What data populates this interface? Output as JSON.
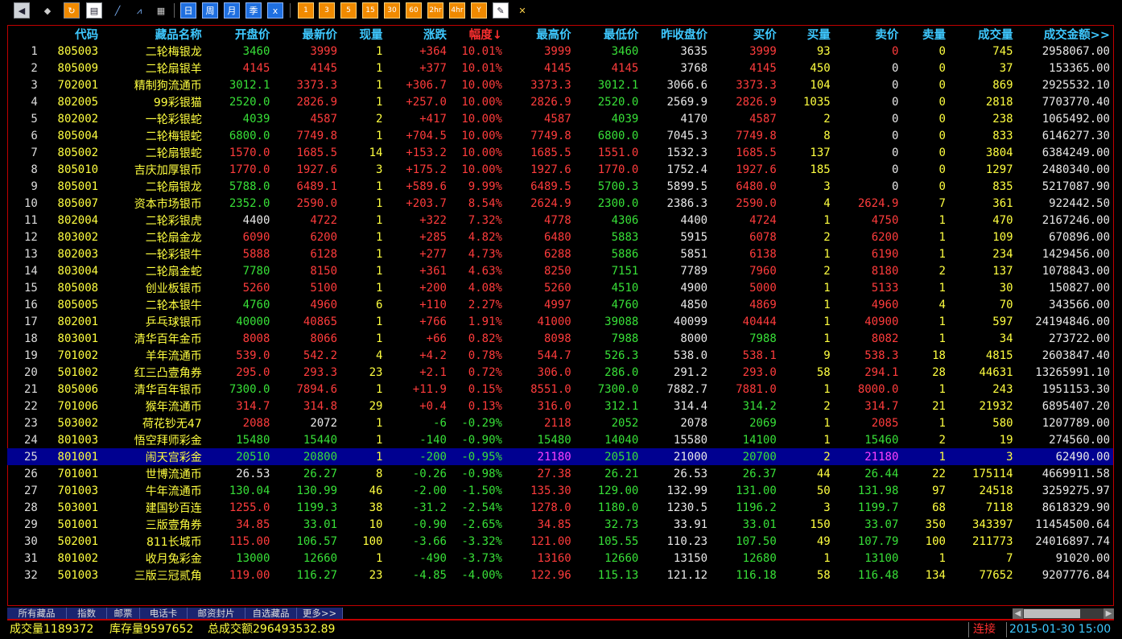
{
  "toolbar": {
    "icons": [
      "back-icon",
      "cube-icon",
      "refresh-icon",
      "quote-list-icon",
      "chart-icon",
      "analysis-icon",
      "table-icon"
    ],
    "periods": [
      "日",
      "周",
      "月",
      "季",
      "x"
    ],
    "minutes": [
      "1",
      "3",
      "5",
      "15",
      "30",
      "60",
      "2hr",
      "4hr",
      "Y"
    ],
    "tools": [
      "edit-icon",
      "tools-icon"
    ]
  },
  "headers": [
    "",
    "代码",
    "藏品名称",
    "开盘价",
    "最新价",
    "现量",
    "涨跌",
    "幅度↓",
    "最高价",
    "最低价",
    "昨收盘价",
    "买价",
    "买量",
    "卖价",
    "卖量",
    "成交量",
    "成交金额>>"
  ],
  "rows": [
    [
      "1",
      "805003",
      "二轮梅银龙",
      "3460",
      "3999",
      "1",
      "+364",
      "10.01%",
      "3999",
      "3460",
      "3635",
      "3999",
      "93",
      "0",
      "0",
      "745",
      "2958067.00"
    ],
    [
      "2",
      "805009",
      "二轮扇银羊",
      "4145",
      "4145",
      "1",
      "+377",
      "10.01%",
      "4145",
      "4145",
      "3768",
      "4145",
      "450",
      "0",
      "0",
      "37",
      "153365.00"
    ],
    [
      "3",
      "702001",
      "精制狗流通币",
      "3012.1",
      "3373.3",
      "1",
      "+306.7",
      "10.00%",
      "3373.3",
      "3012.1",
      "3066.6",
      "3373.3",
      "104",
      "0",
      "0",
      "869",
      "2925532.10"
    ],
    [
      "4",
      "802005",
      "99彩银猫",
      "2520.0",
      "2826.9",
      "1",
      "+257.0",
      "10.00%",
      "2826.9",
      "2520.0",
      "2569.9",
      "2826.9",
      "1035",
      "0",
      "0",
      "2818",
      "7703770.40"
    ],
    [
      "5",
      "802002",
      "一轮彩银蛇",
      "4039",
      "4587",
      "2",
      "+417",
      "10.00%",
      "4587",
      "4039",
      "4170",
      "4587",
      "2",
      "0",
      "0",
      "238",
      "1065492.00"
    ],
    [
      "6",
      "805004",
      "二轮梅银蛇",
      "6800.0",
      "7749.8",
      "1",
      "+704.5",
      "10.00%",
      "7749.8",
      "6800.0",
      "7045.3",
      "7749.8",
      "8",
      "0",
      "0",
      "833",
      "6146277.30"
    ],
    [
      "7",
      "805002",
      "二轮扇银蛇",
      "1570.0",
      "1685.5",
      "14",
      "+153.2",
      "10.00%",
      "1685.5",
      "1551.0",
      "1532.3",
      "1685.5",
      "137",
      "0",
      "0",
      "3804",
      "6384249.00"
    ],
    [
      "8",
      "805010",
      "吉庆加厚银币",
      "1770.0",
      "1927.6",
      "3",
      "+175.2",
      "10.00%",
      "1927.6",
      "1770.0",
      "1752.4",
      "1927.6",
      "185",
      "0",
      "0",
      "1297",
      "2480340.00"
    ],
    [
      "9",
      "805001",
      "二轮扇银龙",
      "5788.0",
      "6489.1",
      "1",
      "+589.6",
      "9.99%",
      "6489.5",
      "5700.3",
      "5899.5",
      "6480.0",
      "3",
      "0",
      "0",
      "835",
      "5217087.90"
    ],
    [
      "10",
      "805007",
      "资本市场银币",
      "2352.0",
      "2590.0",
      "1",
      "+203.7",
      "8.54%",
      "2624.9",
      "2300.0",
      "2386.3",
      "2590.0",
      "4",
      "2624.9",
      "7",
      "361",
      "922442.50"
    ],
    [
      "11",
      "802004",
      "二轮彩银虎",
      "4400",
      "4722",
      "1",
      "+322",
      "7.32%",
      "4778",
      "4306",
      "4400",
      "4724",
      "1",
      "4750",
      "1",
      "470",
      "2167246.00"
    ],
    [
      "12",
      "803002",
      "二轮扇金龙",
      "6090",
      "6200",
      "1",
      "+285",
      "4.82%",
      "6480",
      "5883",
      "5915",
      "6078",
      "2",
      "6200",
      "1",
      "109",
      "670896.00"
    ],
    [
      "13",
      "802003",
      "一轮彩银牛",
      "5888",
      "6128",
      "1",
      "+277",
      "4.73%",
      "6288",
      "5886",
      "5851",
      "6138",
      "1",
      "6190",
      "1",
      "234",
      "1429456.00"
    ],
    [
      "14",
      "803004",
      "二轮扇金蛇",
      "7780",
      "8150",
      "1",
      "+361",
      "4.63%",
      "8250",
      "7151",
      "7789",
      "7960",
      "2",
      "8180",
      "2",
      "137",
      "1078843.00"
    ],
    [
      "15",
      "805008",
      "创业板银币",
      "5260",
      "5100",
      "1",
      "+200",
      "4.08%",
      "5260",
      "4510",
      "4900",
      "5000",
      "1",
      "5133",
      "1",
      "30",
      "150827.00"
    ],
    [
      "16",
      "805005",
      "二轮本银牛",
      "4760",
      "4960",
      "6",
      "+110",
      "2.27%",
      "4997",
      "4760",
      "4850",
      "4869",
      "1",
      "4960",
      "4",
      "70",
      "343566.00"
    ],
    [
      "17",
      "802001",
      "乒乓球银币",
      "40000",
      "40865",
      "1",
      "+766",
      "1.91%",
      "41000",
      "39088",
      "40099",
      "40444",
      "1",
      "40900",
      "1",
      "597",
      "24194846.00"
    ],
    [
      "18",
      "803001",
      "清华百年金币",
      "8008",
      "8066",
      "1",
      "+66",
      "0.82%",
      "8098",
      "7988",
      "8000",
      "7988",
      "1",
      "8082",
      "1",
      "34",
      "273722.00"
    ],
    [
      "19",
      "701002",
      "羊年流通币",
      "539.0",
      "542.2",
      "4",
      "+4.2",
      "0.78%",
      "544.7",
      "526.3",
      "538.0",
      "538.1",
      "9",
      "538.3",
      "18",
      "4815",
      "2603847.40"
    ],
    [
      "20",
      "501002",
      "红三凸壹角券",
      "295.0",
      "293.3",
      "23",
      "+2.1",
      "0.72%",
      "306.0",
      "286.0",
      "291.2",
      "293.0",
      "58",
      "294.1",
      "28",
      "44631",
      "13265991.10"
    ],
    [
      "21",
      "805006",
      "清华百年银币",
      "7300.0",
      "7894.6",
      "1",
      "+11.9",
      "0.15%",
      "8551.0",
      "7300.0",
      "7882.7",
      "7881.0",
      "1",
      "8000.0",
      "1",
      "243",
      "1951153.30"
    ],
    [
      "22",
      "701006",
      "猴年流通币",
      "314.7",
      "314.8",
      "29",
      "+0.4",
      "0.13%",
      "316.0",
      "312.1",
      "314.4",
      "314.2",
      "2",
      "314.7",
      "21",
      "21932",
      "6895407.20"
    ],
    [
      "23",
      "503002",
      "荷花钞无47",
      "2088",
      "2072",
      "1",
      "-6",
      "-0.29%",
      "2118",
      "2052",
      "2078",
      "2069",
      "1",
      "2085",
      "1",
      "580",
      "1207789.00"
    ],
    [
      "24",
      "801003",
      "悟空拜师彩金",
      "15480",
      "15440",
      "1",
      "-140",
      "-0.90%",
      "15480",
      "14040",
      "15580",
      "14100",
      "1",
      "15460",
      "2",
      "19",
      "274560.00"
    ],
    [
      "25",
      "801001",
      "闹天宫彩金",
      "20510",
      "20800",
      "1",
      "-200",
      "-0.95%",
      "21180",
      "20510",
      "21000",
      "20700",
      "2",
      "21180",
      "1",
      "3",
      "62490.00"
    ],
    [
      "26",
      "701001",
      "世博流通币",
      "26.53",
      "26.27",
      "8",
      "-0.26",
      "-0.98%",
      "27.38",
      "26.21",
      "26.53",
      "26.37",
      "44",
      "26.44",
      "22",
      "175114",
      "4669911.58"
    ],
    [
      "27",
      "701003",
      "牛年流通币",
      "130.04",
      "130.99",
      "46",
      "-2.00",
      "-1.50%",
      "135.30",
      "129.00",
      "132.99",
      "131.00",
      "50",
      "131.98",
      "97",
      "24518",
      "3259275.97"
    ],
    [
      "28",
      "503001",
      "建国钞百连",
      "1255.0",
      "1199.3",
      "38",
      "-31.2",
      "-2.54%",
      "1278.0",
      "1180.0",
      "1230.5",
      "1196.2",
      "3",
      "1199.7",
      "68",
      "7118",
      "8618329.90"
    ],
    [
      "29",
      "501001",
      "三版壹角券",
      "34.85",
      "33.01",
      "10",
      "-0.90",
      "-2.65%",
      "34.85",
      "32.73",
      "33.91",
      "33.01",
      "150",
      "33.07",
      "350",
      "343397",
      "11454500.64"
    ],
    [
      "30",
      "502001",
      "811长城币",
      "115.00",
      "106.57",
      "100",
      "-3.66",
      "-3.32%",
      "121.00",
      "105.55",
      "110.23",
      "107.50",
      "49",
      "107.79",
      "100",
      "211773",
      "24016897.74"
    ],
    [
      "31",
      "801002",
      "收月兔彩金",
      "13000",
      "12660",
      "1",
      "-490",
      "-3.73%",
      "13160",
      "12660",
      "13150",
      "12680",
      "1",
      "13100",
      "1",
      "7",
      "91020.00"
    ],
    [
      "32",
      "501003",
      "三版三冠贰角",
      "119.00",
      "116.27",
      "23",
      "-4.85",
      "-4.00%",
      "122.96",
      "115.13",
      "121.12",
      "116.18",
      "58",
      "116.48",
      "134",
      "77652",
      "9207776.84"
    ]
  ],
  "colors": [
    [
      "",
      "yl",
      "yl",
      "dn",
      "up",
      "yl",
      "up",
      "up",
      "up",
      "dn",
      "wh",
      "up",
      "yl",
      "up",
      "yl",
      "yl",
      "wh"
    ],
    [
      "",
      "yl",
      "yl",
      "up",
      "up",
      "yl",
      "up",
      "up",
      "up",
      "up",
      "wh",
      "up",
      "yl",
      "wh",
      "yl",
      "yl",
      "wh"
    ],
    [
      "",
      "yl",
      "yl",
      "dn",
      "up",
      "yl",
      "up",
      "up",
      "up",
      "dn",
      "wh",
      "up",
      "yl",
      "wh",
      "yl",
      "yl",
      "wh"
    ],
    [
      "",
      "yl",
      "yl",
      "dn",
      "up",
      "yl",
      "up",
      "up",
      "up",
      "dn",
      "wh",
      "up",
      "yl",
      "wh",
      "yl",
      "yl",
      "wh"
    ],
    [
      "",
      "yl",
      "yl",
      "dn",
      "up",
      "yl",
      "up",
      "up",
      "up",
      "dn",
      "wh",
      "up",
      "yl",
      "wh",
      "yl",
      "yl",
      "wh"
    ],
    [
      "",
      "yl",
      "yl",
      "dn",
      "up",
      "yl",
      "up",
      "up",
      "up",
      "dn",
      "wh",
      "up",
      "yl",
      "wh",
      "yl",
      "yl",
      "wh"
    ],
    [
      "",
      "yl",
      "yl",
      "up",
      "up",
      "yl",
      "up",
      "up",
      "up",
      "up",
      "wh",
      "up",
      "yl",
      "wh",
      "yl",
      "yl",
      "wh"
    ],
    [
      "",
      "yl",
      "yl",
      "up",
      "up",
      "yl",
      "up",
      "up",
      "up",
      "up",
      "wh",
      "up",
      "yl",
      "wh",
      "yl",
      "yl",
      "wh"
    ],
    [
      "",
      "yl",
      "yl",
      "dn",
      "up",
      "yl",
      "up",
      "up",
      "up",
      "dn",
      "wh",
      "up",
      "yl",
      "wh",
      "yl",
      "yl",
      "wh"
    ],
    [
      "",
      "yl",
      "yl",
      "dn",
      "up",
      "yl",
      "up",
      "up",
      "up",
      "dn",
      "wh",
      "up",
      "yl",
      "up",
      "yl",
      "yl",
      "wh"
    ],
    [
      "",
      "yl",
      "yl",
      "wh",
      "up",
      "yl",
      "up",
      "up",
      "up",
      "dn",
      "wh",
      "up",
      "yl",
      "up",
      "yl",
      "yl",
      "wh"
    ],
    [
      "",
      "yl",
      "yl",
      "up",
      "up",
      "yl",
      "up",
      "up",
      "up",
      "dn",
      "wh",
      "up",
      "yl",
      "up",
      "yl",
      "yl",
      "wh"
    ],
    [
      "",
      "yl",
      "yl",
      "up",
      "up",
      "yl",
      "up",
      "up",
      "up",
      "dn",
      "wh",
      "up",
      "yl",
      "up",
      "yl",
      "yl",
      "wh"
    ],
    [
      "",
      "yl",
      "yl",
      "dn",
      "up",
      "yl",
      "up",
      "up",
      "up",
      "dn",
      "wh",
      "up",
      "yl",
      "up",
      "yl",
      "yl",
      "wh"
    ],
    [
      "",
      "yl",
      "yl",
      "up",
      "up",
      "yl",
      "up",
      "up",
      "up",
      "dn",
      "wh",
      "up",
      "yl",
      "up",
      "yl",
      "yl",
      "wh"
    ],
    [
      "",
      "yl",
      "yl",
      "dn",
      "up",
      "yl",
      "up",
      "up",
      "up",
      "dn",
      "wh",
      "up",
      "yl",
      "up",
      "yl",
      "yl",
      "wh"
    ],
    [
      "",
      "yl",
      "yl",
      "dn",
      "up",
      "yl",
      "up",
      "up",
      "up",
      "dn",
      "wh",
      "up",
      "yl",
      "up",
      "yl",
      "yl",
      "wh"
    ],
    [
      "",
      "yl",
      "yl",
      "up",
      "up",
      "yl",
      "up",
      "up",
      "up",
      "dn",
      "wh",
      "dn",
      "yl",
      "up",
      "yl",
      "yl",
      "wh"
    ],
    [
      "",
      "yl",
      "yl",
      "up",
      "up",
      "yl",
      "up",
      "up",
      "up",
      "dn",
      "wh",
      "up",
      "yl",
      "up",
      "yl",
      "yl",
      "wh"
    ],
    [
      "",
      "yl",
      "yl",
      "up",
      "up",
      "yl",
      "up",
      "up",
      "up",
      "dn",
      "wh",
      "up",
      "yl",
      "up",
      "yl",
      "yl",
      "wh"
    ],
    [
      "",
      "yl",
      "yl",
      "dn",
      "up",
      "yl",
      "up",
      "up",
      "up",
      "dn",
      "wh",
      "up",
      "yl",
      "up",
      "yl",
      "yl",
      "wh"
    ],
    [
      "",
      "yl",
      "yl",
      "up",
      "up",
      "yl",
      "up",
      "up",
      "up",
      "dn",
      "wh",
      "dn",
      "yl",
      "up",
      "yl",
      "yl",
      "wh"
    ],
    [
      "",
      "yl",
      "yl",
      "up",
      "wh",
      "yl",
      "dn",
      "dn",
      "up",
      "dn",
      "wh",
      "dn",
      "yl",
      "up",
      "yl",
      "yl",
      "wh"
    ],
    [
      "",
      "yl",
      "yl",
      "dn",
      "dn",
      "yl",
      "dn",
      "dn",
      "dn",
      "dn",
      "wh",
      "dn",
      "yl",
      "dn",
      "yl",
      "yl",
      "wh"
    ],
    [
      "",
      "yl",
      "yl",
      "dn",
      "dn",
      "yl",
      "dn",
      "dn",
      "hl",
      "dn",
      "wh",
      "dn",
      "yl",
      "hl",
      "yl",
      "yl",
      "wh"
    ],
    [
      "",
      "yl",
      "yl",
      "wh",
      "dn",
      "yl",
      "dn",
      "dn",
      "up",
      "dn",
      "wh",
      "dn",
      "yl",
      "dn",
      "yl",
      "yl",
      "wh"
    ],
    [
      "",
      "yl",
      "yl",
      "dn",
      "dn",
      "yl",
      "dn",
      "dn",
      "up",
      "dn",
      "wh",
      "dn",
      "yl",
      "dn",
      "yl",
      "yl",
      "wh"
    ],
    [
      "",
      "yl",
      "yl",
      "up",
      "dn",
      "yl",
      "dn",
      "dn",
      "up",
      "dn",
      "wh",
      "dn",
      "yl",
      "dn",
      "yl",
      "yl",
      "wh"
    ],
    [
      "",
      "yl",
      "yl",
      "up",
      "dn",
      "yl",
      "dn",
      "dn",
      "up",
      "dn",
      "wh",
      "dn",
      "yl",
      "dn",
      "yl",
      "yl",
      "wh"
    ],
    [
      "",
      "yl",
      "yl",
      "up",
      "dn",
      "yl",
      "dn",
      "dn",
      "up",
      "dn",
      "wh",
      "dn",
      "yl",
      "dn",
      "yl",
      "yl",
      "wh"
    ],
    [
      "",
      "yl",
      "yl",
      "dn",
      "dn",
      "yl",
      "dn",
      "dn",
      "up",
      "dn",
      "wh",
      "dn",
      "yl",
      "dn",
      "yl",
      "yl",
      "wh"
    ],
    [
      "",
      "yl",
      "yl",
      "up",
      "dn",
      "yl",
      "dn",
      "dn",
      "up",
      "dn",
      "wh",
      "dn",
      "yl",
      "dn",
      "yl",
      "yl",
      "wh"
    ]
  ],
  "selected_row": 24,
  "tabs": [
    "所有藏品",
    "指数",
    "邮票",
    "电话卡",
    "邮资封片",
    "自选藏品",
    "更多>>"
  ],
  "status": {
    "volume": "成交量1189372",
    "stock": "库存量9597652",
    "amount": "总成交额296493532.89",
    "connection": "连接",
    "datetime": "2015-01-30 15:00"
  },
  "theme": {
    "up": "#ff3c3c",
    "down": "#38e038",
    "header": "#3ec8ff",
    "name": "#ffff40",
    "select_bg": "#000090",
    "frame": "#c00000"
  }
}
